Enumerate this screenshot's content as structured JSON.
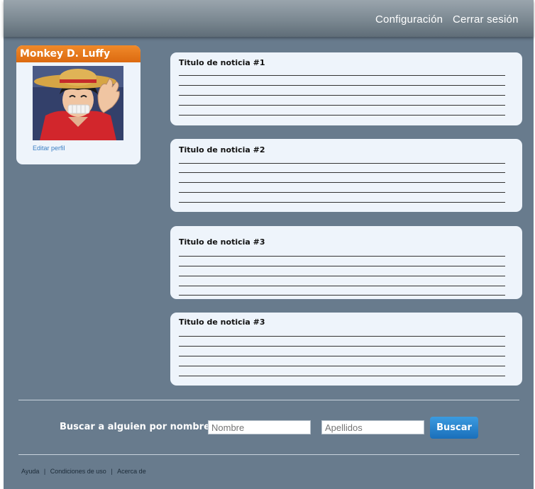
{
  "topbar": {
    "config": "Configuración",
    "logout": "Cerrar sesión"
  },
  "profile": {
    "name": "Monkey D. Luffy",
    "edit": "Editar perfil"
  },
  "news": [
    {
      "title": "Titulo de noticia #1"
    },
    {
      "title": "Titulo de noticia #2"
    },
    {
      "title": "Titulo de noticia #3"
    },
    {
      "title": "Titulo de noticia #3"
    }
  ],
  "search": {
    "label": "Buscar a alguien por nombre:",
    "nombre_placeholder": "Nombre",
    "apellidos_placeholder": "Apellidos",
    "button": "Buscar"
  },
  "footer": {
    "help": "Ayuda",
    "terms": "Condiciones de uso",
    "about": "Acerca de",
    "separator": "|"
  }
}
